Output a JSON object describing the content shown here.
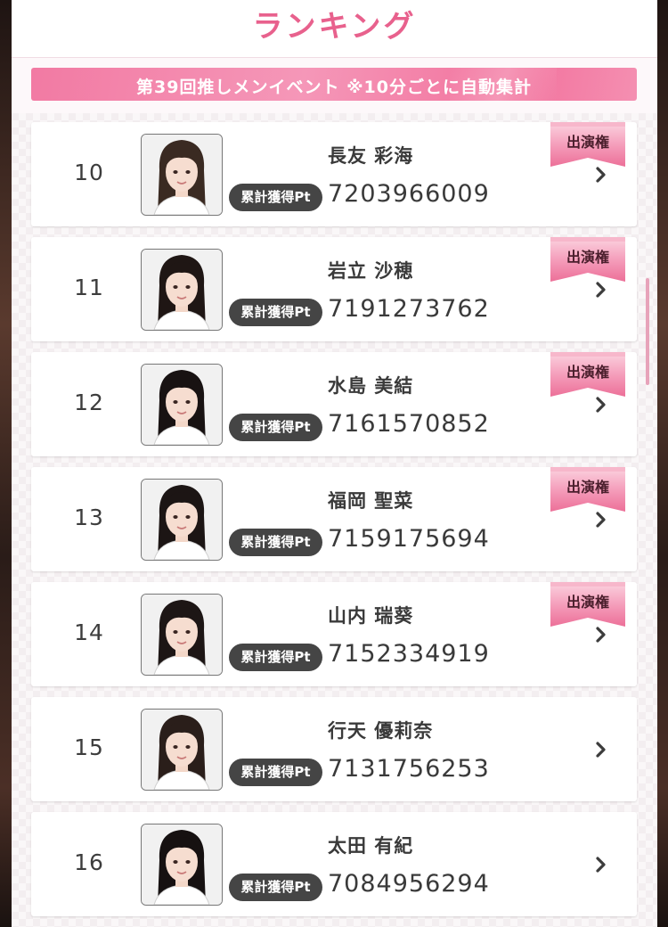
{
  "header": {
    "title": "ランキング"
  },
  "event_banner": {
    "text": "第39回推しメンイベント ※10分ごとに自動集計"
  },
  "colors": {
    "accent_pink": "#e8618d",
    "banner_pink": "#f27aa3",
    "badge_dark": "#454545"
  },
  "rankings": [
    {
      "rank": "10",
      "name": "長友 彩海",
      "badge": "累計獲得Pt",
      "points": "7203966009",
      "ribbon": "出演権",
      "hair": "#3a2a22"
    },
    {
      "rank": "11",
      "name": "岩立 沙穂",
      "badge": "累計獲得Pt",
      "points": "7191273762",
      "ribbon": "出演権",
      "hair": "#1f1614"
    },
    {
      "rank": "12",
      "name": "水島 美結",
      "badge": "累計獲得Pt",
      "points": "7161570852",
      "ribbon": "出演権",
      "hair": "#181212"
    },
    {
      "rank": "13",
      "name": "福岡 聖菜",
      "badge": "累計獲得Pt",
      "points": "7159175694",
      "ribbon": "出演権",
      "hair": "#1c1514"
    },
    {
      "rank": "14",
      "name": "山内 瑞葵",
      "badge": "累計獲得Pt",
      "points": "7152334919",
      "ribbon": "出演権",
      "hair": "#1d1615"
    },
    {
      "rank": "15",
      "name": "行天 優莉奈",
      "badge": "累計獲得Pt",
      "points": "7131756253",
      "ribbon": "",
      "hair": "#2a1e1a"
    },
    {
      "rank": "16",
      "name": "太田 有紀",
      "badge": "累計獲得Pt",
      "points": "7084956294",
      "ribbon": "",
      "hair": "#161111"
    }
  ]
}
